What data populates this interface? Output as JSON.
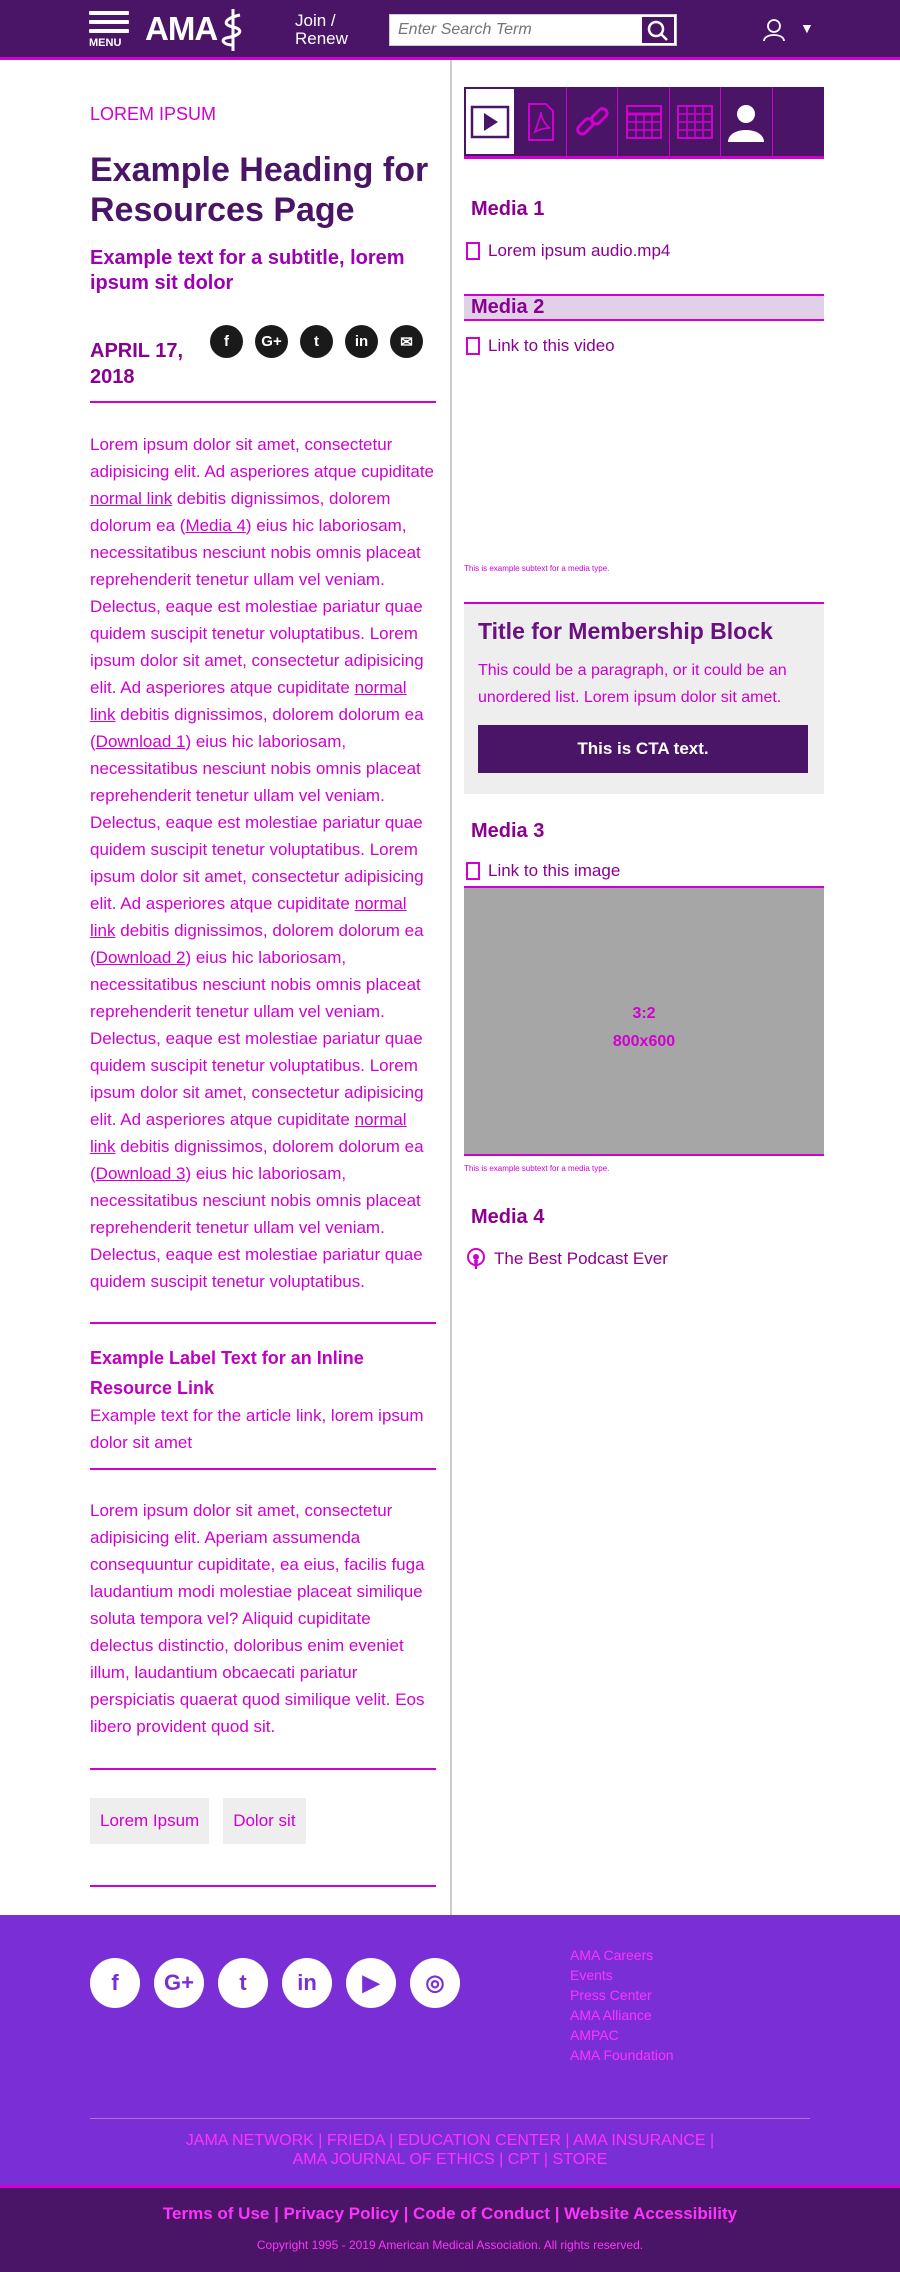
{
  "header": {
    "menu_label": "MENU",
    "logo_text": "AMA",
    "join_line1": "Join /",
    "join_line2": "Renew",
    "search_placeholder": "Enter Search Term"
  },
  "article": {
    "eyebrow": "LOREM IPSUM",
    "title": "Example Heading for Resources Page",
    "subtitle": "Example text for a subtitle, lorem ipsum sit dolor",
    "date": "APRIL 17, 2018",
    "share": [
      "f",
      "G+",
      "t",
      "in",
      "✉"
    ],
    "p1_a": "Lorem ipsum dolor sit amet, consectetur adipisicing elit. Ad asperiores atque cupiditate ",
    "p1_link": "normal link",
    "p1_b": " debitis dignissimos, dolorem dolorum ea (",
    "p1_media": "Media 4",
    "p1_c": ") eius hic laboriosam, necessitatibus nesciunt nobis omnis placeat reprehenderit tenetur ullam vel veniam. Delectus, eaque est molestiae pariatur quae quidem suscipit tenetur voluptatibus. Lorem ipsum dolor sit amet, consectetur adipisicing elit. Ad asperiores atque cupiditate ",
    "p1_link2": "normal link",
    "p1_d": " debitis dignissimos, dolorem dolorum ea (",
    "p1_dl1": "Download 1",
    "p1_e": ") eius hic laboriosam, necessitatibus nesciunt nobis omnis placeat reprehenderit tenetur ullam vel veniam. Delectus, eaque est molestiae pariatur quae quidem suscipit tenetur voluptatibus. Lorem ipsum dolor sit amet, consectetur adipisicing elit. Ad asperiores atque cupiditate ",
    "p1_link3": "normal link",
    "p1_f": " debitis dignissimos, dolorem dolorum ea (",
    "p1_dl2": "Download 2",
    "p1_g": ") eius hic laboriosam, necessitatibus nesciunt nobis omnis placeat reprehenderit tenetur ullam vel veniam. Delectus, eaque est molestiae pariatur quae quidem suscipit tenetur voluptatibus. Lorem ipsum dolor sit amet, consectetur adipisicing elit. Ad asperiores atque cupiditate ",
    "p1_link4": "normal link",
    "p1_h": " debitis dignissimos, dolorem dolorum ea (",
    "p1_dl3": "Download 3",
    "p1_i": ") eius hic laboriosam, necessitatibus nesciunt nobis omnis placeat reprehenderit tenetur ullam vel veniam. Delectus, eaque est molestiae pariatur quae quidem suscipit tenetur voluptatibus.",
    "inline_label": "Example Label Text for an Inline Resource Link",
    "inline_desc": "Example text for the article link, lorem ipsum dolor sit amet",
    "p2": "Lorem ipsum dolor sit amet, consectetur adipisicing elit. Aperiam assumenda consequuntur cupiditate, ea eius, facilis fuga laudantium modi molestiae placeat similique soluta tempora vel? Aliquid cupiditate delectus distinctio, doloribus enim eveniet illum, laudantium obcaecati pariatur perspiciatis quaerat quod similique velit. Eos libero provident quod sit.",
    "tags": [
      "Lorem Ipsum",
      "Dolor sit"
    ]
  },
  "sidebar": {
    "tab_icons": [
      "play-icon",
      "pdf-icon",
      "link-icon",
      "table-icon",
      "grid-icon",
      "person-icon"
    ],
    "media1_title": "Media 1",
    "media1_link": "Lorem ipsum audio.mp4",
    "media2_title": "Media 2",
    "media2_link": "Link to this video",
    "media2_subtext": "This is example subtext for a media type.",
    "membership_title": "Title for Membership Block",
    "membership_text": "This could be a paragraph, or it could be an unordered list. Lorem ipsum dolor sit amet.",
    "cta": "This is CTA text.",
    "media3_title": "Media 3",
    "media3_link": "Link to this image",
    "image_ratio": "3:2",
    "image_size": "800x600",
    "media3_subtext": "This is example subtext for a media type.",
    "media4_title": "Media 4",
    "media4_link": "The Best Podcast Ever"
  },
  "footer": {
    "social": [
      "f",
      "G+",
      "t",
      "in",
      "▶",
      "◎"
    ],
    "links": [
      "AMA Careers",
      "Events",
      "Press Center",
      "AMA Alliance",
      "AMPAC",
      "AMA Foundation"
    ],
    "nav_line1": "JAMA NETWORK  |  FRIEDA  |  EDUCATION CENTER  |  AMA INSURANCE  |",
    "nav_line2": "AMA JOURNAL OF ETHICS  |  CPT  |  STORE",
    "legal": "Terms of Use  |  Privacy Policy  |  Code of Conduct  |  Website Accessibility",
    "copyright": "Copyright 1995 - 2019 American Medical Association. All rights reserved."
  },
  "colors": {
    "brand_purple": "#4a1566",
    "accent_magenta": "#d000d0",
    "footer_purple": "#7a2fd6"
  }
}
